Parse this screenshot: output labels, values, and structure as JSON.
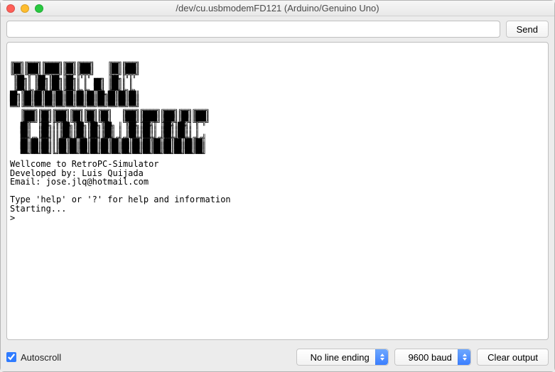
{
  "window": {
    "title": "/dev/cu.usbmodemFD121 (Arduino/Genuino Uno)"
  },
  "toolbar": {
    "input_value": "",
    "send_label": "Send"
  },
  "ascii_art": "╔══╗╔═══╗╔════╗╔══╗╔═══╗    ╔══╗╔═══╗\n║██║║███║║████║║██║║███║    ║██║║███║\n║██║║███║║████║║██║║███║    ║██║║███║\n╚╦╦╝╚╦═╦╝╚═╦╦═╝╚╦╦╝╚╦═╦╝    ╚╦╦╝╚╦═╦╝\n ║██╗║ ║██╗║██╗║██╗║ ║  ══╗ ║██╗║ ║\n ║██║║ ║██║║██║║██║║ ║  ██║ ║██║║ ║\n ║██║║ ║██║║██║║██║║ ║  ██║ ║██║║ ║\n ╚═╦╝╚╗╚═╦╝╚═╦╝╚═╦╝╚╗╚╗ ═╦╝ ╚═╦╝╚╗╚╗\n██╗║██║██║██║██║██║██║██║██╗██║██║██║\n██║║██║██║██║██║██║██║██║██║██║██║██║\n██║║██║██║██║██║██║██║██║██║██║██║██║\n══╝╚══╝══╝══╝══╝══╝══╝══╝══╝══╝══╝══╝\n   ╔═══╗╔══╗╔═══╗╔══╗╔══╗╔══╗   ╔═══╗╔════╗╔═══╗╔══╗╔═══╗\n   ║███║║██║║███║║██║║██║║██║   ║███║║████║║███║║██║║███║\n   ║███║║██║║███║║██║║██║║██║   ║███║║████║║███║║██║║███║\n   ╚═╦═╝╚╦╦╝╚╦╦╦╝╚╦╦╝╚╦╦╝╚╦╦╝   ╚╦═╦╝╚═╦╦═╝╚╦═╦╝╚╦╦╝╚╦═╦╝\n   ██║  ║██╗║║║██╗║██╗║██╗║██╗ ║ ║██╗║██╗║ ║██╗║██╗║ ║\n   ██║  ║██║║║║██║║██║║██║║██║ ║ ║██║║██║║ ║██║║██║║ ║\n   ██║  ║██║║║║██║║██║║██║║██║ ║ ║██║║██║║ ║██║║██║║ ║\n   ═╦╝╔╗╚═╦╝║║╚═╦╝╚═╦╝╚═╦╝╚═╦╝╔╝╔╝╚═╦╝╚═╦╝╔╝╚═╦╝╚═╦╝╔╝╔╝\n   ██║██║██║║║██║██║██║██║██║██║██║██║██║██║██║██║██║██║\n   ██║██║██║║║██║██║██║██║██║██║██║██║██║██║██║██║██║██║\n   ██║██║██║║║██║██║██║██║██║██║██║██║██║██║██║██║██║██║\n   ══╝══╝══╝╚╝══╝══╝══╝══╝══╝══╝══╝══╝══╝══╝══╝══╝══╝══╝",
  "output_text": "Wellcome to RetroPC-Simulator\nDeveloped by: Luis Quijada\nEmail: jose.jlq@hotmail.com\n\nType 'help' or '?' for help and information\nStarting...\n>",
  "status": {
    "autoscroll_label": "Autoscroll",
    "autoscroll_checked": true,
    "line_ending_selected": "No line ending",
    "baud_selected": "9600 baud",
    "clear_label": "Clear output"
  }
}
